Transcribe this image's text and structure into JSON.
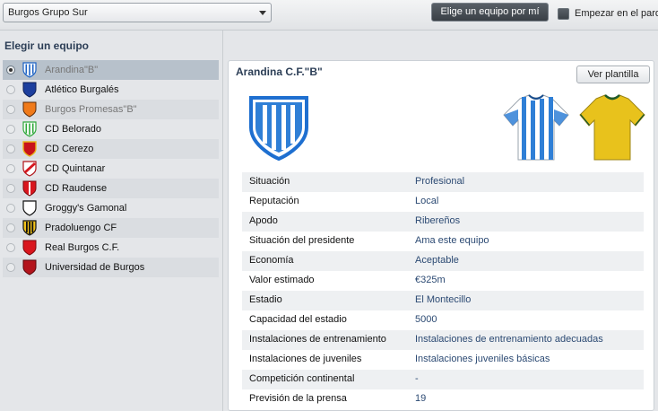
{
  "topbar": {
    "division_select": "Burgos Grupo Sur",
    "choose_button": "Elige un equipo por mí",
    "start_checkbox_label": "Empezar en el paro"
  },
  "left": {
    "header": "Elegir un equipo",
    "teams": [
      {
        "name": "Arandina\"B\"",
        "selected": true,
        "dim": true
      },
      {
        "name": "Atlético Burgalés"
      },
      {
        "name": "Burgos Promesas\"B\"",
        "dim": true
      },
      {
        "name": "CD Belorado"
      },
      {
        "name": "CD Cerezo"
      },
      {
        "name": "CD Quintanar"
      },
      {
        "name": "CD Raudense"
      },
      {
        "name": "Groggy's Gamonal"
      },
      {
        "name": "Pradoluengo CF"
      },
      {
        "name": "Real Burgos C.F."
      },
      {
        "name": "Universidad de Burgos"
      }
    ]
  },
  "panel": {
    "title": "Arandina C.F.\"B\"",
    "squad_button": "Ver plantilla",
    "info": [
      {
        "label": "Situación",
        "value": "Profesional"
      },
      {
        "label": "Reputación",
        "value": "Local"
      },
      {
        "label": "Apodo",
        "value": "Ribereños"
      },
      {
        "label": "Situación del presidente",
        "value": "Ama este equipo"
      },
      {
        "label": "Economía",
        "value": "Aceptable"
      },
      {
        "label": "Valor estimado",
        "value": "€325m"
      },
      {
        "label": "Estadio",
        "value": "El Montecillo"
      },
      {
        "label": "Capacidad del estadio",
        "value": "5000"
      },
      {
        "label": "Instalaciones de entrenamiento",
        "value": "Instalaciones de entrenamiento adecuadas"
      },
      {
        "label": "Instalaciones de juveniles",
        "value": "Instalaciones juveniles básicas"
      },
      {
        "label": "Competición continental",
        "value": "-"
      },
      {
        "label": "Previsión de la prensa",
        "value": "19"
      }
    ]
  },
  "colors": {
    "accent": "#2c3e56",
    "value_text": "#2c4a73",
    "home_kit_blue": "#2f7fd6",
    "away_kit_yellow": "#e8c21c"
  }
}
